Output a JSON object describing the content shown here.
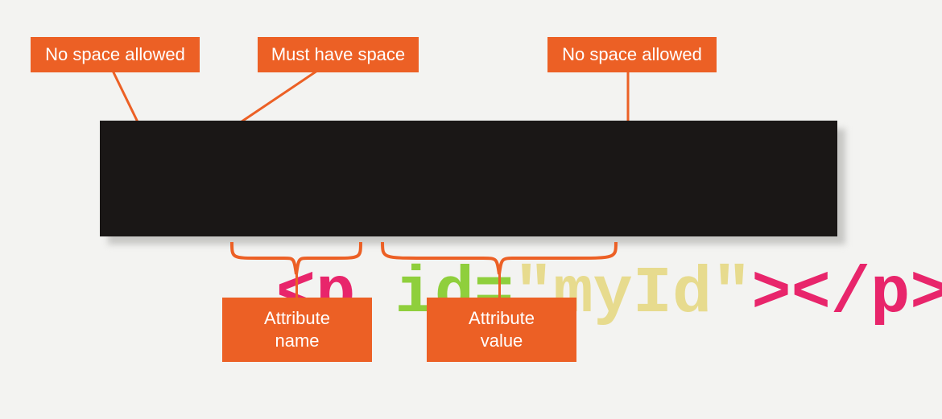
{
  "callouts": {
    "no_space_left": "No space allowed",
    "must_have_space": "Must have space",
    "no_space_right": "No space allowed",
    "attr_name": "Attribute\nname",
    "attr_value": "Attribute\nvalue"
  },
  "code": {
    "open_lt": "<",
    "tag_p": "p",
    "id_eq": "id=",
    "quote1": "\"",
    "value": "myId",
    "quote2": "\"",
    "close_gt": ">",
    "close_tag": "</p>"
  },
  "colors": {
    "callout_bg": "#ec6025",
    "code_bg": "#1a1716",
    "pink": "#e8256b",
    "green": "#8fcf3c",
    "yellow": "#e7db8e"
  }
}
